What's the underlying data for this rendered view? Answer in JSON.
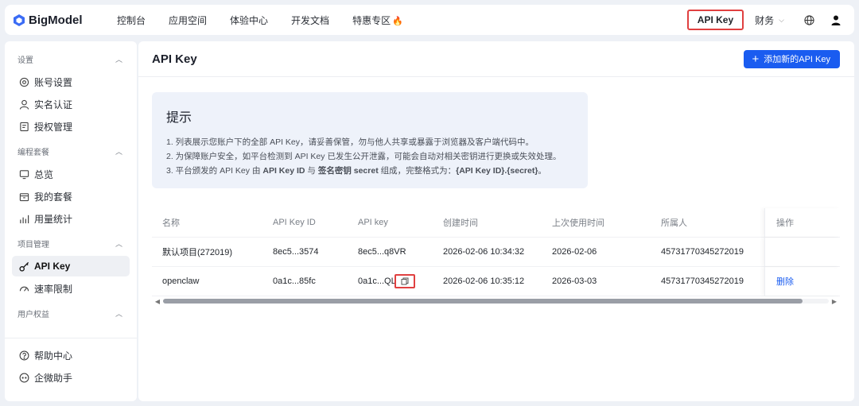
{
  "brand": {
    "name": "BigModel",
    "accent": "#1a5cf0"
  },
  "nav": {
    "items": [
      "控制台",
      "应用空间",
      "体验中心",
      "开发文档",
      "特惠专区"
    ],
    "special_icon": "fire-icon"
  },
  "topbar": {
    "api_key": "API Key",
    "finance": "财务"
  },
  "sidebar": {
    "sections": [
      {
        "title": "设置",
        "items": [
          "账号设置",
          "实名认证",
          "授权管理"
        ]
      },
      {
        "title": "编程套餐",
        "items": [
          "总览",
          "我的套餐",
          "用量统计"
        ]
      },
      {
        "title": "项目管理",
        "items": [
          "API Key",
          "速率限制"
        ]
      },
      {
        "title": "用户权益"
      }
    ],
    "bottom": [
      "帮助中心",
      "企微助手"
    ]
  },
  "main": {
    "title": "API Key",
    "add_button": "添加新的API Key"
  },
  "tip": {
    "title": "提示",
    "line1": "1. 列表展示您账户下的全部 API Key，请妥善保管，勿与他人共享或暴露于浏览器及客户端代码中。",
    "line2": "2. 为保障账户安全，如平台检测到 API Key 已发生公开泄露，可能会自动对相关密钥进行更换或失效处理。",
    "line3_pre": "3. 平台颁发的 API Key 由 ",
    "line3_b1": "API Key ID",
    "line3_mid1": " 与 ",
    "line3_b2": "签名密钥 secret",
    "line3_mid2": " 组成，完整格式为：",
    "line3_b3": "{API Key ID}.{secret}",
    "line3_end": "。"
  },
  "table": {
    "headers": [
      "名称",
      "API Key ID",
      "API key",
      "创建时间",
      "上次使用时间",
      "所属人",
      "操作"
    ],
    "rows": [
      {
        "name": "默认项目(272019)",
        "key_id": "8ec5...3574",
        "key": "8ec5...q8VR",
        "created": "2026-02-06 10:34:32",
        "last_used": "2026-02-06",
        "owner": "45731770345272019",
        "action": ""
      },
      {
        "name": "openclaw",
        "key_id": "0a1c...85fc",
        "key": "0a1c...QLi",
        "created": "2026-02-06 10:35:12",
        "last_used": "2026-03-03",
        "owner": "45731770345272019",
        "action": "删除"
      }
    ]
  }
}
